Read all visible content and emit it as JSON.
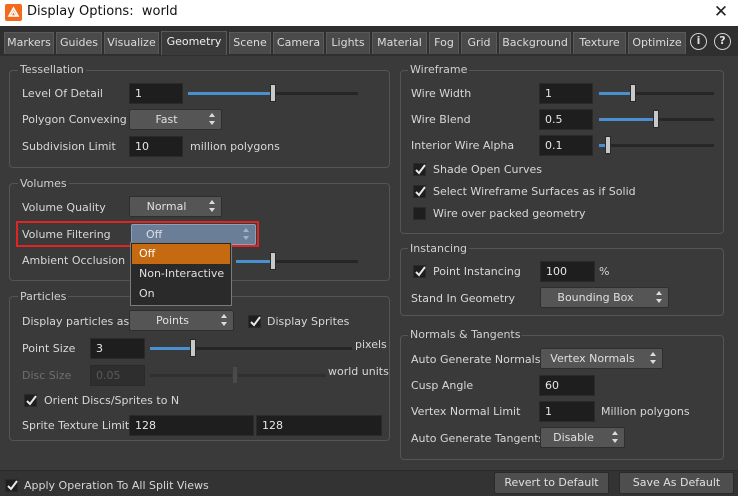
{
  "window": {
    "title": "Display Options:  world",
    "close_icon": "close-icon"
  },
  "tabs": [
    "Markers",
    "Guides",
    "Visualize",
    "Geometry",
    "Scene",
    "Camera",
    "Lights",
    "Material",
    "Fog",
    "Grid",
    "Background",
    "Texture",
    "Optimize"
  ],
  "active_tab": "Geometry",
  "help": {
    "info_label": "i",
    "question_label": "?"
  },
  "tessellation": {
    "title": "Tessellation",
    "lod_label": "Level Of Detail",
    "lod_value": "1",
    "lod_slider": 0.5,
    "polygon_convexing_label": "Polygon Convexing",
    "polygon_convexing_value": "Fast",
    "subdivision_label": "Subdivision Limit",
    "subdivision_value": "10",
    "subdivision_unit": "million polygons"
  },
  "volumes": {
    "title": "Volumes",
    "quality_label": "Volume Quality",
    "quality_value": "Normal",
    "filtering_label": "Volume Filtering",
    "filtering_value": "Off",
    "ambient_label": "Ambient Occlusion",
    "filtering_options": [
      "Off",
      "Non-Interactive",
      "On"
    ],
    "filtering_selected": "Off"
  },
  "particles": {
    "title": "Particles",
    "display_as_label": "Display particles as",
    "display_as_value": "Points",
    "display_sprites_label": "Display Sprites",
    "display_sprites_checked": true,
    "point_size_label": "Point Size",
    "point_size_value": "3",
    "point_size_unit": "pixels",
    "point_size_slider": 0.4,
    "disc_size_label": "Disc Size",
    "disc_size_value": "0.05",
    "disc_size_unit": "world units",
    "orient_label": "Orient Discs/Sprites to N",
    "orient_checked": true,
    "sprite_limit_label": "Sprite Texture Limit",
    "sprite_limit_x": "128",
    "sprite_limit_y": "128"
  },
  "wireframe": {
    "title": "Wireframe",
    "width_label": "Wire Width",
    "width_value": "1",
    "width_slider": 0.3,
    "blend_label": "Wire Blend",
    "blend_value": "0.5",
    "blend_slider": 0.5,
    "alpha_label": "Interior Wire Alpha",
    "alpha_value": "0.1",
    "alpha_slider": 0.06,
    "shade_open_label": "Shade Open Curves",
    "shade_open_checked": true,
    "select_wire_label": "Select Wireframe Surfaces as if Solid",
    "select_wire_checked": true,
    "wire_packed_label": "Wire over packed geometry",
    "wire_packed_checked": false
  },
  "instancing": {
    "title": "Instancing",
    "point_label": "Point Instancing",
    "point_checked": true,
    "point_value": "100",
    "point_unit": "%",
    "stand_in_label": "Stand In Geometry",
    "stand_in_value": "Bounding Box"
  },
  "normals": {
    "title": "Normals & Tangents",
    "auto_normals_label": "Auto Generate Normals",
    "auto_normals_value": "Vertex Normals",
    "cusp_label": "Cusp Angle",
    "cusp_value": "60",
    "vnl_label": "Vertex Normal Limit",
    "vnl_value": "1",
    "vnl_unit": "Million polygons",
    "auto_tangents_label": "Auto Generate Tangents",
    "auto_tangents_value": "Disable"
  },
  "footer": {
    "apply_label": "Apply Operation To All Split Views",
    "apply_checked": true,
    "revert_label": "Revert to Default",
    "save_label": "Save As Default"
  },
  "colors": {
    "accent": "#c66a12",
    "slider": "#4a8fd0",
    "highlight": "#e02424",
    "background": "#3a3a3a"
  }
}
